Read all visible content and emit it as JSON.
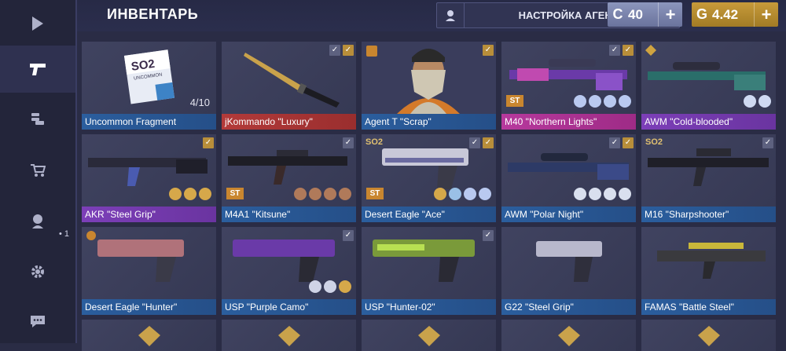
{
  "header": {
    "title": "ИНВЕНТАРЬ",
    "agent_button_label": "НАСТРОЙКА АГЕНТА",
    "silver_symbol": "C",
    "silver_value": "40",
    "gold_symbol": "G",
    "gold_value": "4.42",
    "plus": "+"
  },
  "sidebar": {
    "items": [
      {
        "icon": "play-icon"
      },
      {
        "icon": "pistol-icon"
      },
      {
        "icon": "coins-icon"
      },
      {
        "icon": "cart-icon"
      },
      {
        "icon": "agent-icon",
        "badge": "• 1"
      },
      {
        "icon": "gear-icon"
      },
      {
        "icon": "chat-icon"
      }
    ]
  },
  "inventory": {
    "rows": [
      [
        {
          "name": "Uncommon Fragment",
          "rarity": "blue",
          "progress": "4/10",
          "fragment_title": "SO2",
          "fragment_sub": "UNCOMMON"
        },
        {
          "name": "jKommando \"Luxury\"",
          "rarity": "red"
        },
        {
          "name": "Agent T \"Scrap\"",
          "rarity": "blue"
        },
        {
          "name": "M40 \"Northern Lights\"",
          "rarity": "pink",
          "st": "ST"
        },
        {
          "name": "AWM \"Cold-blooded\"",
          "rarity": "purple"
        }
      ],
      [
        {
          "name": "AKR \"Steel Grip\"",
          "rarity": "purple"
        },
        {
          "name": "M4A1 \"Kitsune\"",
          "rarity": "blue",
          "st": "ST"
        },
        {
          "name": "Desert Eagle \"Ace\"",
          "rarity": "blue",
          "st": "ST"
        },
        {
          "name": "AWM \"Polar Night\"",
          "rarity": "blue"
        },
        {
          "name": "M16 \"Sharpshooter\"",
          "rarity": "blue"
        }
      ],
      [
        {
          "name": "Desert Eagle \"Hunter\"",
          "rarity": "blue"
        },
        {
          "name": "USP \"Purple Camo\"",
          "rarity": "blue"
        },
        {
          "name": "USP \"Hunter-02\"",
          "rarity": "blue"
        },
        {
          "name": "G22 \"Steel Grip\"",
          "rarity": "blue"
        },
        {
          "name": "FAMAS \"Battle Steel\"",
          "rarity": "blue"
        }
      ]
    ],
    "check": "✓",
    "so2_tag": "SO2"
  },
  "colors": {
    "blue": "#2b5e9e",
    "red": "#b33a3a",
    "pink": "#b7399d",
    "purple": "#7c3fb8",
    "gold": "#c79b3a",
    "silver": "#8c96bd"
  }
}
